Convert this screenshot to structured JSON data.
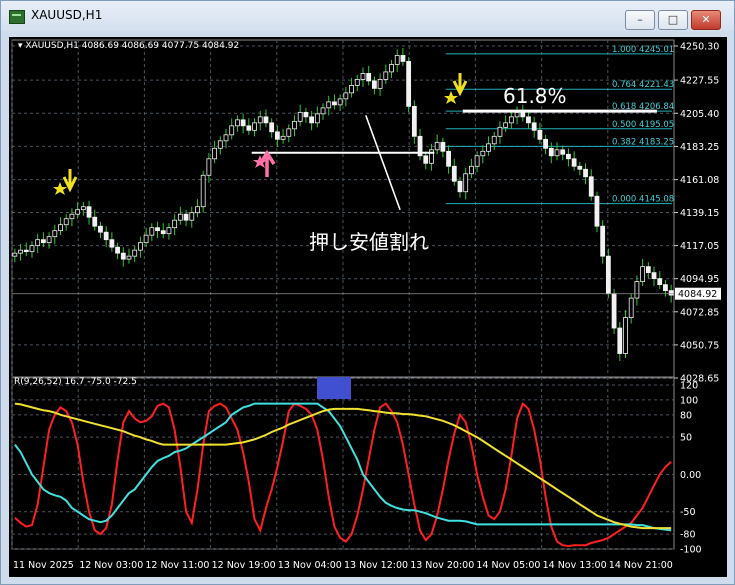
{
  "window": {
    "title": "XAUUSD,H1",
    "buttons": {
      "minimize": "–",
      "maximize": "□",
      "close": "✕"
    }
  },
  "chart_data": [
    {
      "type": "candlestick",
      "header": "XAUUSD,H1  4086.69 4086.69 4077.75 4084.92",
      "ylim": [
        4028.65,
        4250.3
      ],
      "y_ticks": [
        "4250.30",
        "4227.55",
        "4205.40",
        "4183.25",
        "4161.08",
        "4139.15",
        "4117.05",
        "4094.95",
        "4072.85",
        "4050.75",
        "4028.65"
      ],
      "current_price": "4084.92",
      "x_ticks": [
        "11 Nov 2025",
        "12 Nov 03:00",
        "12 Nov 11:00",
        "12 Nov 19:00",
        "13 Nov 04:00",
        "13 Nov 12:00",
        "13 Nov 20:00",
        "14 Nov 05:00",
        "14 Nov 13:00",
        "14 Nov 21:00"
      ],
      "close": [
        4112,
        4114,
        4113,
        4117,
        4121,
        4119,
        4123,
        4127,
        4131,
        4135,
        4138,
        4141,
        4143,
        4136,
        4130,
        4126,
        4121,
        4116,
        4112,
        4108,
        4110,
        4114,
        4119,
        4124,
        4129,
        4127,
        4125,
        4129,
        4134,
        4138,
        4134,
        4139,
        4143,
        4164,
        4175,
        4182,
        4187,
        4191,
        4197,
        4201,
        4197,
        4194,
        4199,
        4203,
        4199,
        4193,
        4188,
        4190,
        4195,
        4200,
        4206,
        4203,
        4199,
        4205,
        4209,
        4213,
        4211,
        4215,
        4219,
        4224,
        4228,
        4232,
        4227,
        4222,
        4228,
        4233,
        4238,
        4244,
        4240,
        4210,
        4190,
        4177,
        4172,
        4181,
        4186,
        4180,
        4170,
        4160,
        4153,
        4165,
        4170,
        4177,
        4180,
        4185,
        4190,
        4196,
        4199,
        4203,
        4206,
        4203,
        4199,
        4194,
        4188,
        4182,
        4177,
        4181,
        4178,
        4175,
        4170,
        4168,
        4163,
        4150,
        4130,
        4110,
        4085,
        4062,
        4045,
        4069,
        4082,
        4093,
        4103,
        4099,
        4095,
        4091,
        4087,
        4084
      ],
      "fibonacci": [
        {
          "level": "1.000",
          "price": "4245.01"
        },
        {
          "level": "0.764",
          "price": "4221.43"
        },
        {
          "level": "0.618",
          "price": "4206.84"
        },
        {
          "level": "0.500",
          "price": "4195.05"
        },
        {
          "level": "0.382",
          "price": "4183.25"
        },
        {
          "level": "0.000",
          "price": "4145.08"
        }
      ],
      "annotations": {
        "fib_label": "61.8%",
        "break_label": "押し安値割れ",
        "support_line_price": 4179
      }
    },
    {
      "type": "line",
      "header": "R(9,26,52) 16.7 -75.0 -72.5",
      "ylim": [
        -100,
        120
      ],
      "y_ticks": [
        "120",
        "100",
        "80",
        "50",
        "0.00",
        "-50",
        "-80",
        "-100"
      ],
      "series": [
        {
          "color": "#ff2020",
          "values": [
            -58,
            -65,
            -70,
            -68,
            -40,
            10,
            60,
            80,
            90,
            85,
            70,
            40,
            -10,
            -50,
            -75,
            -80,
            -72,
            -40,
            20,
            70,
            85,
            75,
            70,
            72,
            78,
            92,
            95,
            90,
            60,
            10,
            -50,
            -65,
            -20,
            40,
            85,
            92,
            95,
            90,
            75,
            60,
            30,
            -10,
            -60,
            -75,
            -45,
            -20,
            10,
            45,
            85,
            95,
            92,
            88,
            80,
            60,
            20,
            -30,
            -70,
            -85,
            -90,
            -80,
            -55,
            -20,
            20,
            60,
            90,
            95,
            85,
            70,
            40,
            0,
            -40,
            -75,
            -88,
            -80,
            -55,
            -20,
            20,
            55,
            80,
            70,
            40,
            0,
            -30,
            -55,
            -60,
            -50,
            -20,
            25,
            75,
            95,
            88,
            60,
            20,
            -30,
            -70,
            -90,
            -95,
            -96,
            -95,
            -95,
            -95,
            -92,
            -90,
            -88,
            -85,
            -80,
            -75,
            -70,
            -65,
            -55,
            -45,
            -30,
            -15,
            0,
            10,
            17
          ]
        },
        {
          "color": "#40e0e0",
          "values": [
            40,
            30,
            15,
            0,
            -10,
            -20,
            -25,
            -28,
            -30,
            -35,
            -45,
            -50,
            -55,
            -60,
            -62,
            -64,
            -62,
            -55,
            -45,
            -35,
            -25,
            -20,
            -10,
            0,
            10,
            18,
            22,
            25,
            30,
            32,
            35,
            40,
            45,
            50,
            55,
            60,
            65,
            70,
            80,
            85,
            90,
            92,
            95,
            95,
            95,
            95,
            95,
            95,
            95,
            95,
            95,
            95,
            95,
            95,
            90,
            85,
            75,
            65,
            50,
            35,
            20,
            0,
            -10,
            -20,
            -30,
            -38,
            -42,
            -45,
            -47,
            -48,
            -48,
            -50,
            -52,
            -55,
            -58,
            -60,
            -62,
            -62,
            -62,
            -63,
            -65,
            -67,
            -67,
            -67,
            -67,
            -67,
            -67,
            -67,
            -67,
            -67,
            -67,
            -67,
            -67,
            -67,
            -67,
            -67,
            -67,
            -67,
            -67,
            -67,
            -67,
            -67,
            -67,
            -67,
            -67,
            -67,
            -67,
            -67,
            -67,
            -68,
            -68,
            -70,
            -72,
            -73,
            -74,
            -75
          ]
        },
        {
          "color": "#f0e030",
          "values": [
            95,
            94,
            92,
            90,
            88,
            86,
            85,
            83,
            80,
            78,
            76,
            74,
            72,
            70,
            68,
            66,
            64,
            62,
            60,
            58,
            55,
            52,
            50,
            47,
            45,
            42,
            40,
            40,
            40,
            40,
            40,
            40,
            40,
            40,
            40,
            40,
            40,
            40,
            41,
            42,
            43,
            45,
            47,
            50,
            53,
            57,
            60,
            63,
            67,
            70,
            73,
            76,
            79,
            82,
            85,
            87,
            88,
            88,
            88,
            88,
            88,
            87,
            86,
            85,
            84,
            83,
            82,
            82,
            81,
            81,
            80,
            79,
            78,
            76,
            74,
            72,
            69,
            66,
            62,
            58,
            54,
            50,
            45,
            40,
            35,
            30,
            25,
            20,
            15,
            10,
            5,
            0,
            -5,
            -10,
            -15,
            -20,
            -25,
            -30,
            -35,
            -40,
            -45,
            -50,
            -55,
            -58,
            -61,
            -64,
            -66,
            -68,
            -70,
            -71,
            -72,
            -72,
            -72,
            -72,
            -72,
            -72
          ]
        }
      ],
      "marker_color": "#4050d0"
    }
  ]
}
